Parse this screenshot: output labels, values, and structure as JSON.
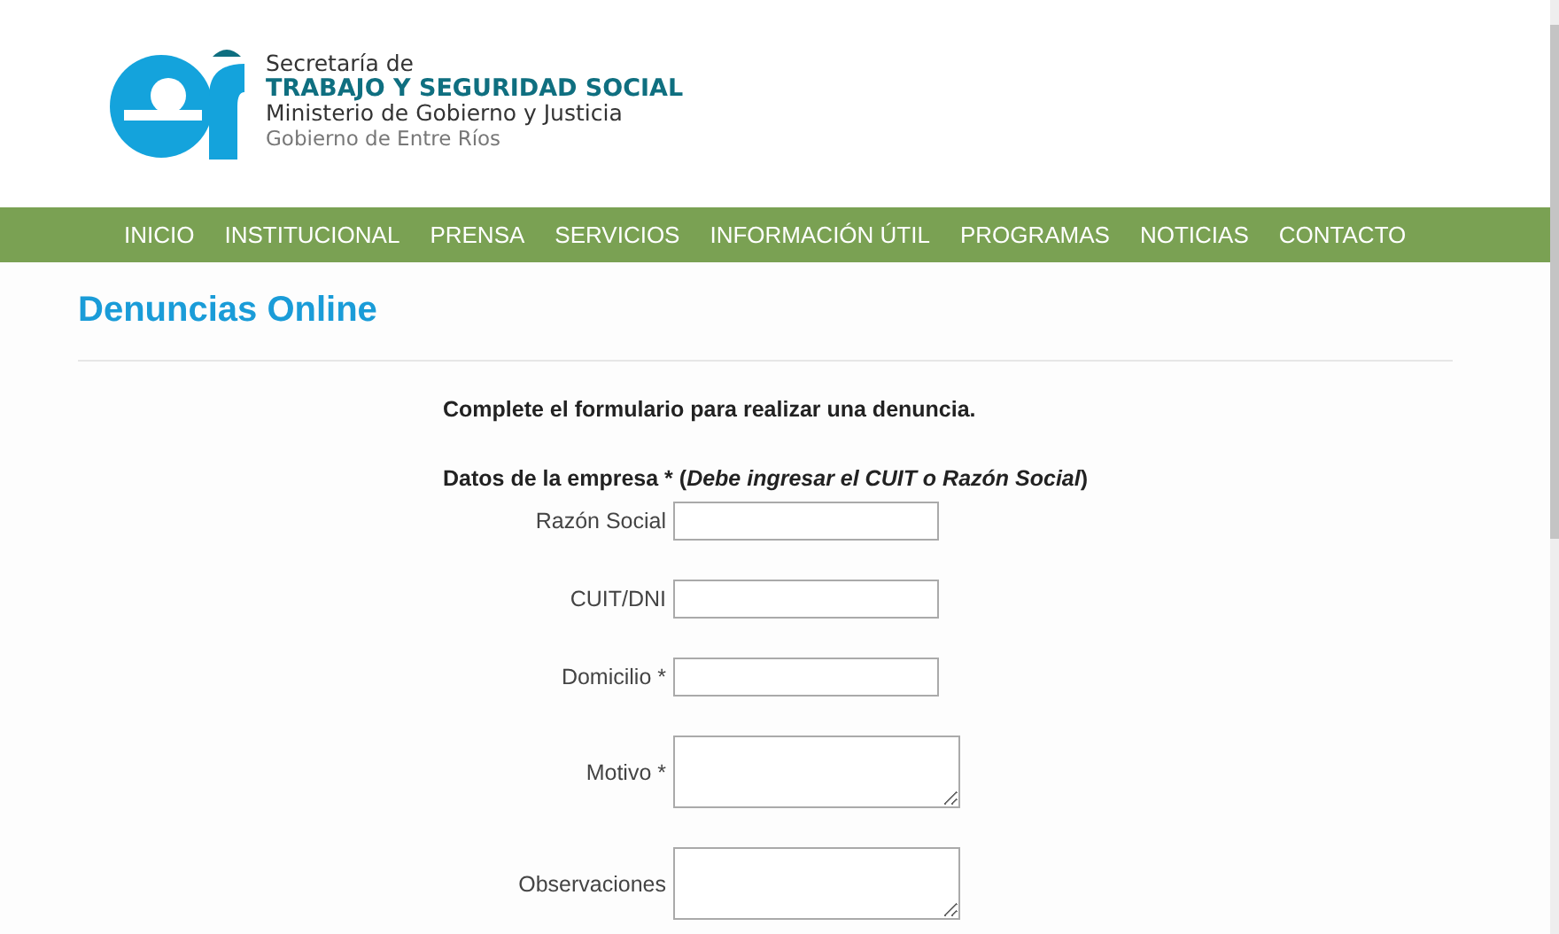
{
  "header": {
    "logo_lines": [
      {
        "kind": "small",
        "text": "Secretaría de"
      },
      {
        "kind": "big",
        "text": "TRABAJO Y SEGURIDAD SOCIAL"
      },
      {
        "kind": "mid",
        "text": "Ministerio de Gobierno y Justicia"
      },
      {
        "kind": "light",
        "text": "Gobierno de Entre Ríos"
      }
    ]
  },
  "nav": [
    "INICIO",
    "INSTITUCIONAL",
    "PRENSA",
    "SERVICIOS",
    "INFORMACIÓN ÚTIL",
    "PROGRAMAS",
    "NOTICIAS",
    "CONTACTO"
  ],
  "page_title": "Denuncias Online",
  "form": {
    "intro": "Complete el formulario para realizar una denuncia.",
    "section": "Datos de la empresa * (*Debe ingresar el CUIT o Razón Social*)",
    "fields": [
      {
        "label": "Razón Social",
        "kind": "input"
      },
      {
        "label": "CUIT/DNI",
        "kind": "input"
      },
      {
        "label": "Domicilio *",
        "kind": "input"
      },
      {
        "label": "Motivo *",
        "kind": "textarea"
      },
      {
        "label": "Observaciones",
        "kind": "textarea"
      }
    ]
  }
}
